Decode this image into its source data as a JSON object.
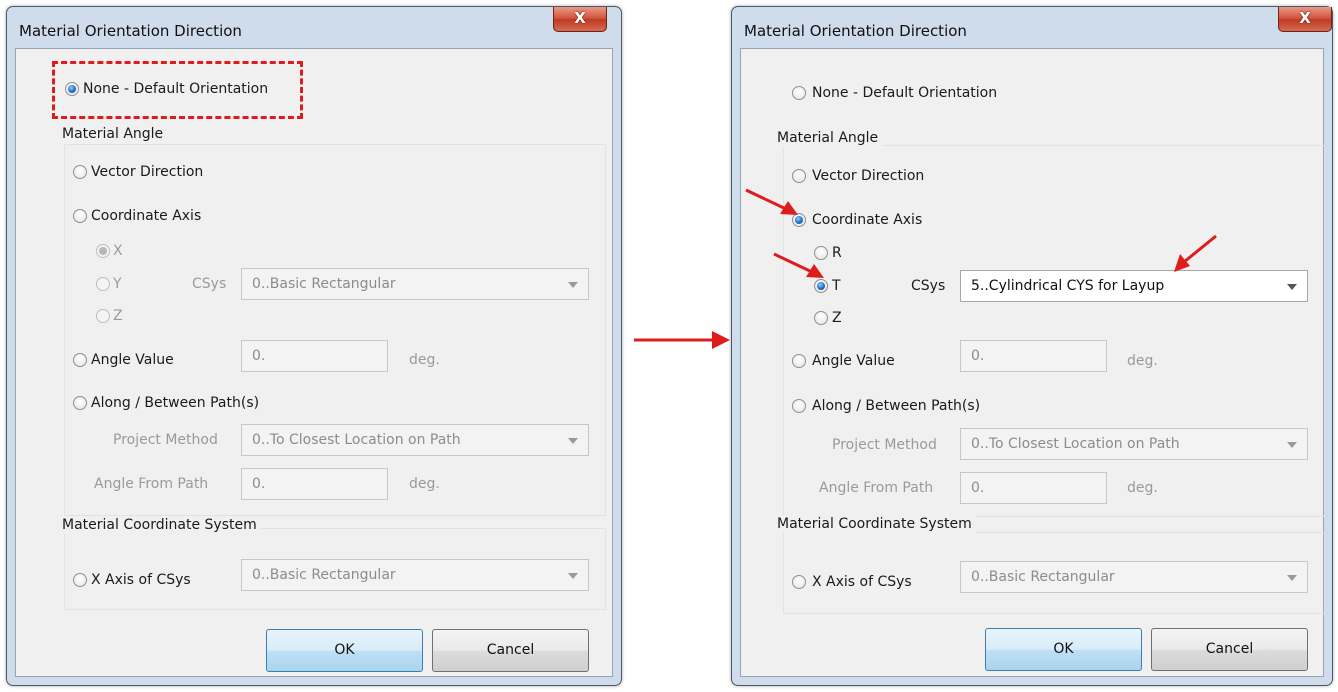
{
  "dialog_title": "Material Orientation Direction",
  "close_glyph": "X",
  "left": {
    "none_label": "None - Default Orientation",
    "material_angle_group": "Material Angle",
    "vector_direction_label": "Vector Direction",
    "coordinate_axis_label": "Coordinate Axis",
    "axis_options": [
      "X",
      "Y",
      "Z"
    ],
    "selected_axis": "X",
    "csys_label": "CSys",
    "csys_value": "0..Basic Rectangular",
    "angle_value_label": "Angle Value",
    "angle_value": "0.",
    "angle_unit": "deg.",
    "along_path_label": "Along / Between Path(s)",
    "project_method_label": "Project Method",
    "project_method_value": "0..To Closest Location on Path",
    "angle_from_path_label": "Angle From Path",
    "angle_from_path_value": "0.",
    "angle_from_path_unit": "deg.",
    "material_cs_group": "Material Coordinate System",
    "x_axis_csys_label": "X Axis of CSys",
    "x_axis_csys_value": "0..Basic Rectangular",
    "selected_option": "None - Default Orientation"
  },
  "right": {
    "none_label": "None - Default Orientation",
    "material_angle_group": "Material Angle",
    "vector_direction_label": "Vector Direction",
    "coordinate_axis_label": "Coordinate Axis",
    "axis_options": [
      "R",
      "T",
      "Z"
    ],
    "selected_axis": "T",
    "csys_label": "CSys",
    "csys_value": "5..Cylindrical CYS for Layup",
    "angle_value_label": "Angle Value",
    "angle_value": "0.",
    "angle_unit": "deg.",
    "along_path_label": "Along / Between Path(s)",
    "project_method_label": "Project Method",
    "project_method_value": "0..To Closest Location on Path",
    "angle_from_path_label": "Angle From Path",
    "angle_from_path_value": "0.",
    "angle_from_path_unit": "deg.",
    "material_cs_group": "Material Coordinate System",
    "x_axis_csys_label": "X Axis of CSys",
    "x_axis_csys_value": "0..Basic Rectangular",
    "selected_option": "Coordinate Axis"
  },
  "buttons": {
    "ok": "OK",
    "cancel": "Cancel"
  },
  "colors": {
    "annotation": "#e01b1b",
    "accent": "#1d6fc2",
    "close_button": "#c7432b"
  }
}
